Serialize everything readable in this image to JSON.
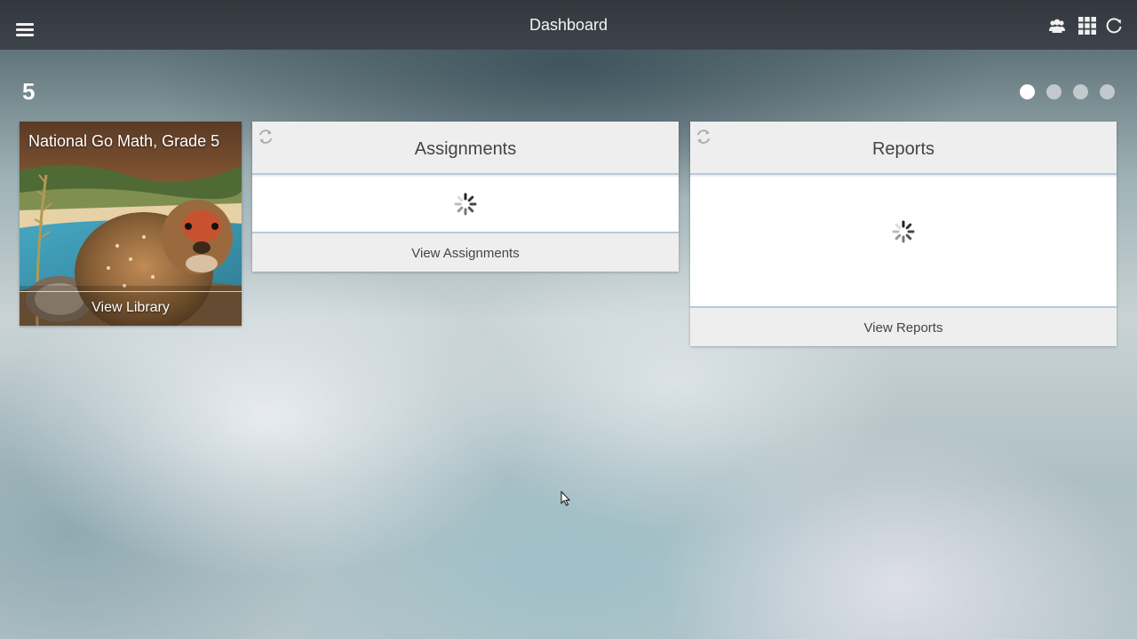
{
  "header": {
    "title": "Dashboard",
    "menu_icon": "hamburger-icon",
    "actions": [
      "users-icon",
      "apps-grid-icon",
      "refresh-icon"
    ]
  },
  "page": {
    "number": "5",
    "pager_total": 4,
    "pager_active": 1
  },
  "library": {
    "title": "National Go Math, Grade 5",
    "link": "View Library"
  },
  "assignments": {
    "title": "Assignments",
    "link": "View Assignments",
    "status": "loading"
  },
  "reports": {
    "title": "Reports",
    "link": "View Reports",
    "status": "loading"
  },
  "colors": {
    "header_bg": "#3a4047",
    "card_bg": "#eeeeee",
    "card_divider": "#b9c8dc",
    "text": "#444444"
  }
}
